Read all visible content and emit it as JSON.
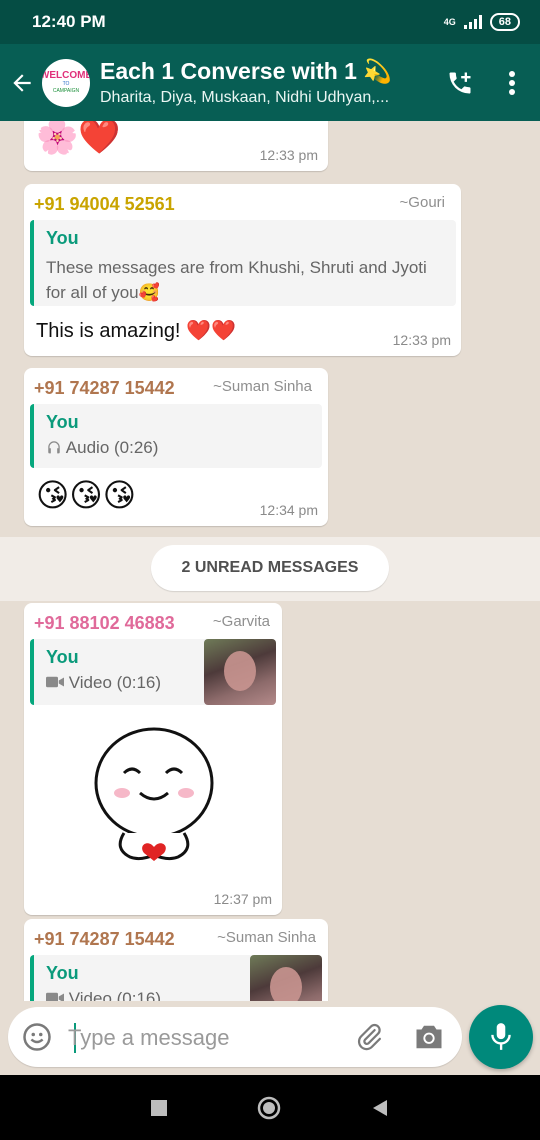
{
  "status": {
    "time": "12:40 PM",
    "network": "4G",
    "battery": "68"
  },
  "header": {
    "avatar_text": [
      "WELCOME",
      "TO",
      "CAMPAIGN"
    ],
    "title": "Each 1 Converse with 1 💫",
    "subtitle": "Dharita, Diya, Muskaan, Nidhi Udhyan,..."
  },
  "messages": [
    {
      "emoji": "🌸❤️",
      "time": "12:33 pm"
    },
    {
      "sender": "+91 94004 52561",
      "sender_color": "#c9a400",
      "alias": "~Gouri",
      "quote_author": "You",
      "quote_text": "These messages are from Khushi, Shruti and Jyoti for all of you🥰",
      "text": "This is amazing! ❤️❤️",
      "time": "12:33 pm"
    },
    {
      "sender": "+91 74287 15442",
      "sender_color": "#b0764f",
      "alias": "~Suman Sinha",
      "quote_author": "You",
      "quote_text": "Audio (0:26)",
      "text": "😘😘😘",
      "time": "12:34 pm"
    },
    {
      "sender": "+91 88102 46883",
      "sender_color": "#e06a9a",
      "alias": "~Garvita",
      "quote_author": "You",
      "quote_text": "Video (0:16)",
      "time": "12:37 pm"
    },
    {
      "sender": "+91 74287 15442",
      "sender_color": "#b0764f",
      "alias": "~Suman Sinha",
      "quote_author": "You",
      "quote_text": "Video (0:16)"
    }
  ],
  "unread_label": "2 UNREAD MESSAGES",
  "input": {
    "placeholder": "Type a message"
  }
}
